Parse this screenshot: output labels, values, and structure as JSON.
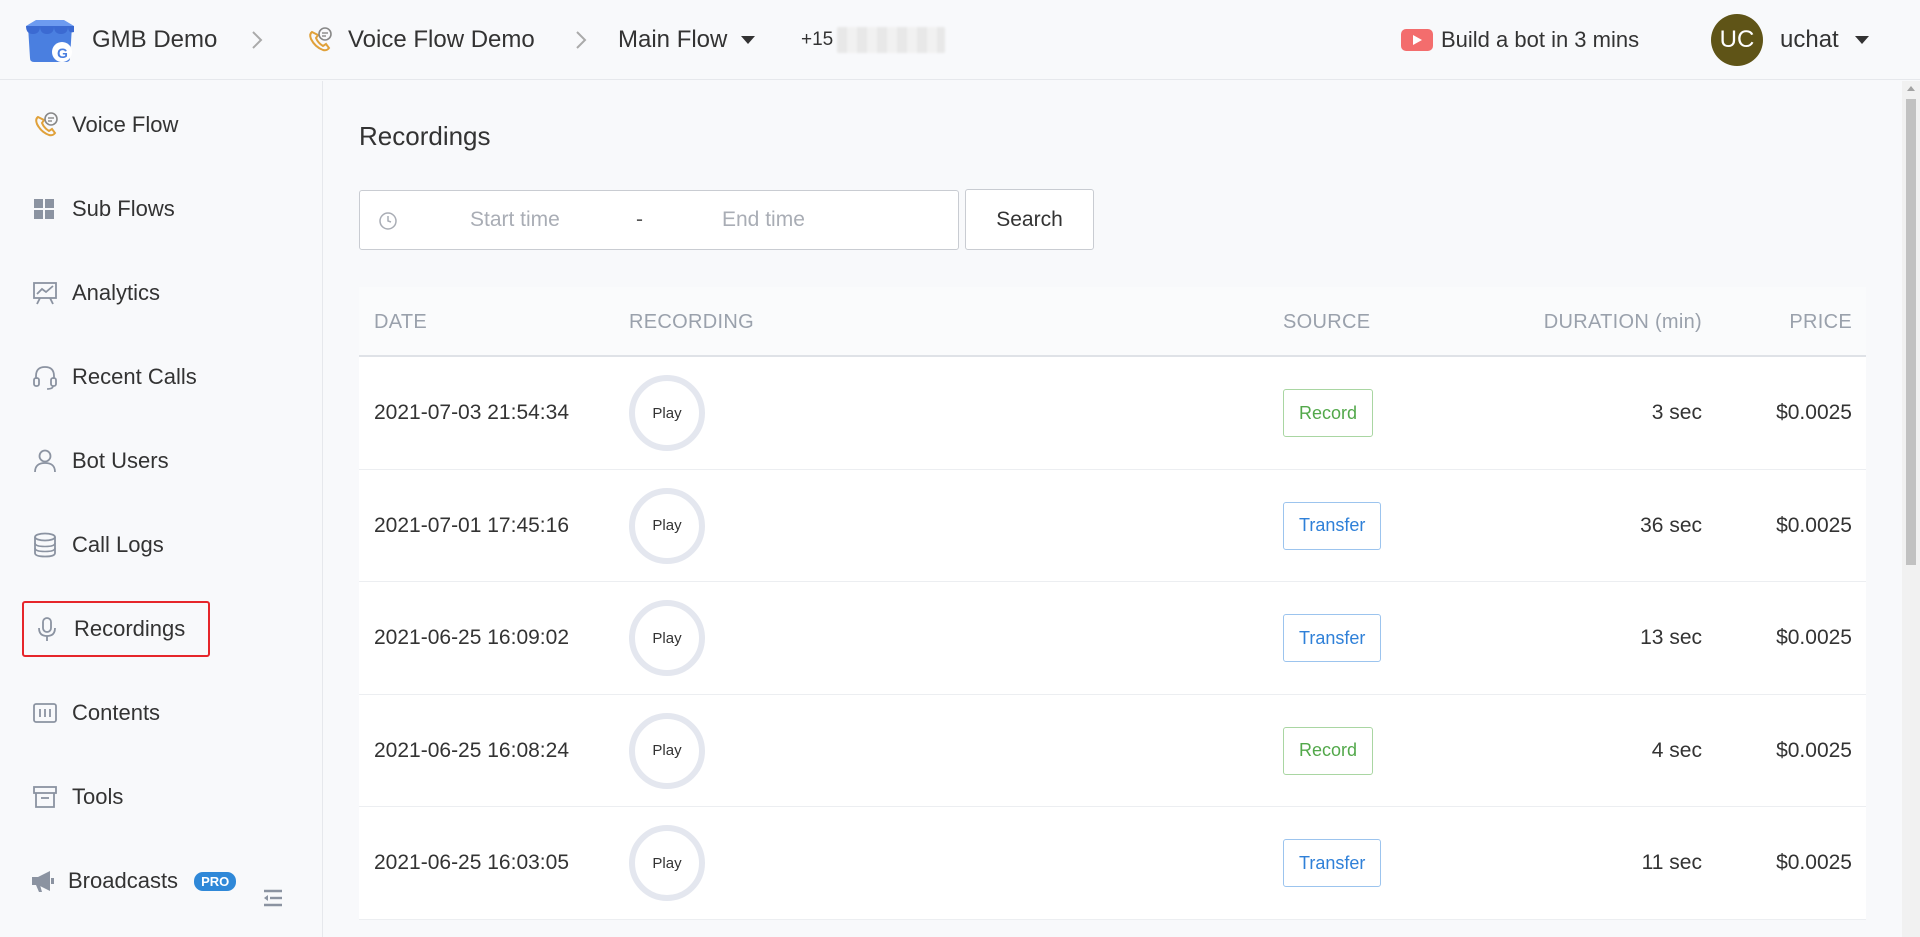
{
  "header": {
    "workspace": "GMB Demo",
    "flow_name": "Voice Flow Demo",
    "current_flow": "Main Flow",
    "phone_prefix": "+15",
    "promo": "Build a bot in 3 mins",
    "avatar_initials": "UC",
    "user_name": "uchat"
  },
  "sidebar": {
    "items": [
      {
        "label": "Voice Flow",
        "icon": "phone-chat-icon"
      },
      {
        "label": "Sub Flows",
        "icon": "grid-icon"
      },
      {
        "label": "Analytics",
        "icon": "chart-board-icon"
      },
      {
        "label": "Recent Calls",
        "icon": "headset-icon"
      },
      {
        "label": "Bot Users",
        "icon": "user-icon"
      },
      {
        "label": "Call Logs",
        "icon": "database-icon"
      },
      {
        "label": "Recordings",
        "icon": "microphone-icon",
        "active": true
      },
      {
        "label": "Contents",
        "icon": "contents-icon"
      },
      {
        "label": "Tools",
        "icon": "archive-box-icon"
      },
      {
        "label": "Broadcasts",
        "icon": "megaphone-icon",
        "badge": "PRO"
      }
    ]
  },
  "main": {
    "title": "Recordings",
    "start_placeholder": "Start time",
    "range_separator": "-",
    "end_placeholder": "End time",
    "search_label": "Search",
    "columns": {
      "date": "DATE",
      "recording": "RECORDING",
      "source": "SOURCE",
      "duration": "DURATION (min)",
      "price": "PRICE"
    },
    "rows": [
      {
        "date": "2021-07-03 21:54:34",
        "play": "Play",
        "source": "Record",
        "duration": "3 sec",
        "price": "$0.0025"
      },
      {
        "date": "2021-07-01 17:45:16",
        "play": "Play",
        "source": "Transfer",
        "duration": "36 sec",
        "price": "$0.0025"
      },
      {
        "date": "2021-06-25 16:09:02",
        "play": "Play",
        "source": "Transfer",
        "duration": "13 sec",
        "price": "$0.0025"
      },
      {
        "date": "2021-06-25 16:08:24",
        "play": "Play",
        "source": "Record",
        "duration": "4 sec",
        "price": "$0.0025"
      },
      {
        "date": "2021-06-25 16:03:05",
        "play": "Play",
        "source": "Transfer",
        "duration": "11 sec",
        "price": "$0.0025"
      }
    ]
  },
  "colors": {
    "active_outline": "#e6262b",
    "record_tag": "#52a84a",
    "transfer_tag": "#2f80d8",
    "pro_badge": "#2f88d8",
    "avatar_bg": "#5f5417"
  }
}
